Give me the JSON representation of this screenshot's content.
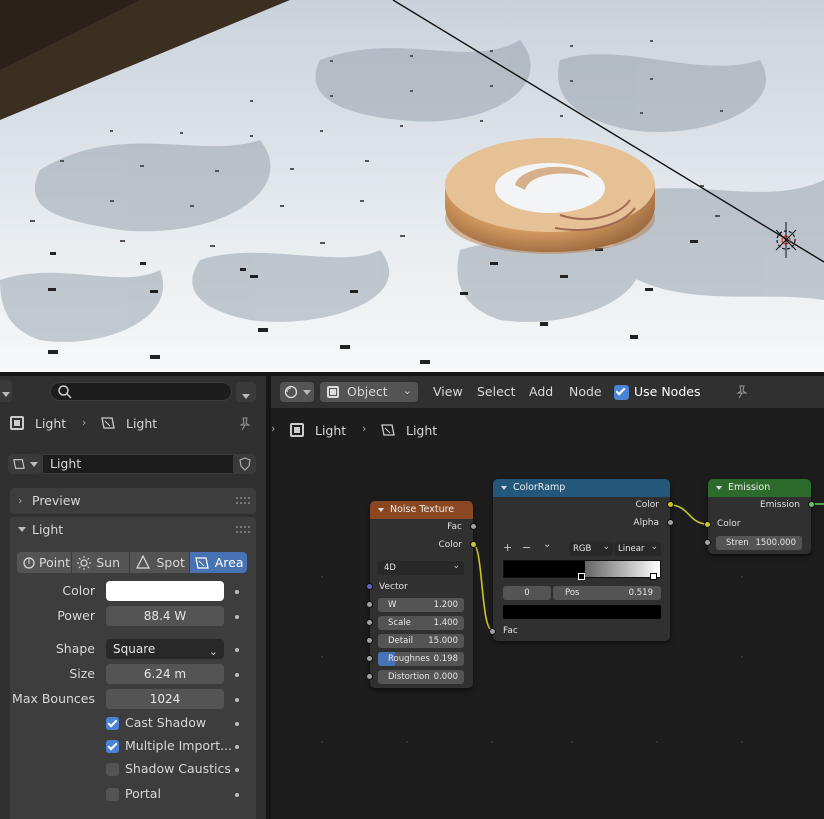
{
  "properties": {
    "search_placeholder": "",
    "breadcrumb": {
      "object": "Light",
      "data": "Light"
    },
    "datablock_name": "Light",
    "preview_header": "Preview",
    "light_header": "Light",
    "light_types": [
      {
        "label": "Point",
        "active": false
      },
      {
        "label": "Sun",
        "active": false
      },
      {
        "label": "Spot",
        "active": false
      },
      {
        "label": "Area",
        "active": true
      }
    ],
    "color_label": "Color",
    "color_value": "#ffffff",
    "power_label": "Power",
    "power_value": "88.4 W",
    "shape_label": "Shape",
    "shape_value": "Square",
    "size_label": "Size",
    "size_value": "6.24 m",
    "max_bounces_label": "Max Bounces",
    "max_bounces_value": "1024",
    "cast_shadow": {
      "label": "Cast Shadow",
      "checked": true
    },
    "multiple_importance": {
      "label": "Multiple Import...",
      "checked": true
    },
    "shadow_caustics": {
      "label": "Shadow Caustics",
      "checked": false
    },
    "portal": {
      "label": "Portal",
      "checked": false
    }
  },
  "node_editor": {
    "header": {
      "object_mode": "Object",
      "menus": [
        "View",
        "Select",
        "Add",
        "Node"
      ],
      "use_nodes_label": "Use Nodes",
      "use_nodes_checked": true
    },
    "breadcrumb": {
      "object": "Light",
      "data": "Light"
    },
    "nodes": {
      "noise": {
        "title": "Noise Texture",
        "header_color": "#8b4721",
        "out_fac": "Fac",
        "out_color": "Color",
        "dimensions": "4D",
        "vector_label": "Vector",
        "fields": [
          {
            "label": "W",
            "value": "1.200"
          },
          {
            "label": "Scale",
            "value": "1.400"
          },
          {
            "label": "Detail",
            "value": "15.000"
          },
          {
            "label": "Roughnes",
            "value": "0.198",
            "fill": 0.198
          },
          {
            "label": "Distortion",
            "value": "0.000"
          }
        ]
      },
      "colorramp": {
        "title": "ColorRamp",
        "header_color": "#24587a",
        "out_color": "Color",
        "out_alpha": "Alpha",
        "add": "+",
        "remove": "−",
        "mode": "RGB",
        "interp": "Linear",
        "index": "0",
        "pos_label": "Pos",
        "pos_value": "0.519",
        "in_fac": "Fac"
      },
      "emission": {
        "title": "Emission",
        "header_color": "#2c6b2c",
        "out_emission": "Emission",
        "in_color": "Color",
        "strength_label": "Stren",
        "strength_value": "1500.000"
      }
    }
  }
}
